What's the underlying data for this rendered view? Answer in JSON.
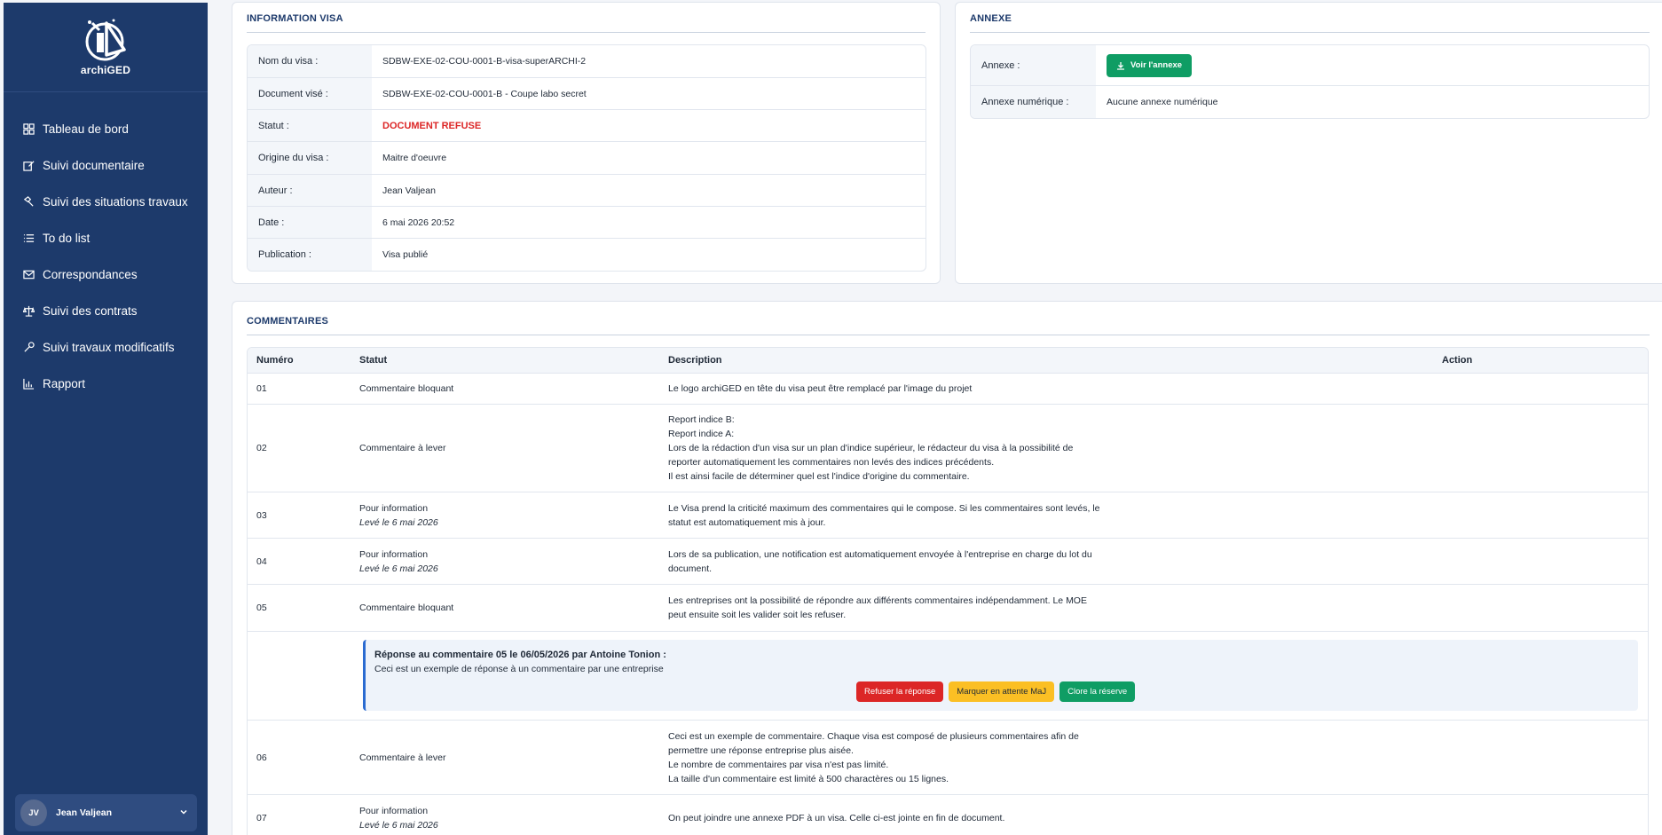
{
  "app": {
    "logo_text": "archiGED"
  },
  "sidebar": {
    "items": [
      {
        "label": "Tableau de bord",
        "icon": "grid-icon"
      },
      {
        "label": "Suivi documentaire",
        "icon": "edit-doc-icon"
      },
      {
        "label": "Suivi des situations travaux",
        "icon": "hammer-icon"
      },
      {
        "label": "To do list",
        "icon": "list-icon"
      },
      {
        "label": "Correspondances",
        "icon": "mail-icon"
      },
      {
        "label": "Suivi des contrats",
        "icon": "scale-icon"
      },
      {
        "label": "Suivi travaux modificatifs",
        "icon": "wrench-icon"
      },
      {
        "label": "Rapport",
        "icon": "bar-chart-icon"
      }
    ],
    "user": {
      "initials": "JV",
      "name": "Jean Valjean"
    }
  },
  "info_visa": {
    "title": "INFORMATION VISA",
    "rows": [
      {
        "label": "Nom du visa :",
        "value": "SDBW-EXE-02-COU-0001-B-visa-superARCHI-2"
      },
      {
        "label": "Document visé :",
        "value": "SDBW-EXE-02-COU-0001-B - Coupe labo secret"
      },
      {
        "label": "Statut :",
        "value": "DOCUMENT REFUSE"
      },
      {
        "label": "Origine du visa :",
        "value": "Maitre d'oeuvre"
      },
      {
        "label": "Auteur :",
        "value": "Jean Valjean"
      },
      {
        "label": "Date :",
        "value": "6 mai 2026 20:52"
      },
      {
        "label": "Publication :",
        "value": "Visa publié"
      }
    ],
    "status_color": "#dc2626"
  },
  "annexe": {
    "title": "ANNEXE",
    "annexe_label": "Annexe :",
    "button_label": "Voir l'annexe",
    "numerique_label": "Annexe numérique :",
    "numerique_value": "Aucune annexe numérique"
  },
  "commentaires": {
    "title": "COMMENTAIRES",
    "headers": {
      "num": "Numéro",
      "statut": "Statut",
      "description": "Description",
      "action": "Action"
    },
    "rows": [
      {
        "num": "01",
        "statut": "Commentaire bloquant",
        "leve": "",
        "desc": [
          "Le logo archiGED en tête du visa peut être remplacé par l'image du projet"
        ]
      },
      {
        "num": "02",
        "statut": "Commentaire à lever",
        "leve": "",
        "desc": [
          "Report indice B:",
          "Report indice A:",
          "Lors de la rédaction d'un visa sur un plan d'indice supérieur, le rédacteur du visa à la possibilité de",
          "reporter automatiquement les commentaires non levés des indices précédents.",
          "Il est ainsi facile de déterminer quel est l'indice d'origine du commentaire."
        ]
      },
      {
        "num": "03",
        "statut": "Pour information",
        "leve": "Levé le 6 mai 2026",
        "desc": [
          "Le Visa prend la criticité maximum des commentaires qui le compose. Si les commentaires sont levés, le",
          "statut est automatiquement mis à jour."
        ]
      },
      {
        "num": "04",
        "statut": "Pour information",
        "leve": "Levé le 6 mai 2026",
        "desc": [
          "Lors de sa publication, une notification est automatiquement envoyée à l'entreprise en charge du lot du",
          "document."
        ]
      },
      {
        "num": "05",
        "statut": "Commentaire bloquant",
        "leve": "",
        "desc": [
          "Les entreprises ont la possibilité de répondre aux différents commentaires indépendamment. Le MOE",
          "peut ensuite soit les valider soit les refuser."
        ]
      },
      {
        "num": "06",
        "statut": "Commentaire à lever",
        "leve": "",
        "desc": [
          "Ceci est un exemple de commentaire. Chaque visa est composé de plusieurs commentaires afin de",
          "permettre une réponse entreprise plus aisée.",
          "Le nombre de commentaires par visa n'est pas limité.",
          "La taille d'un commentaire est limité à 500 charactères ou 15 lignes."
        ]
      },
      {
        "num": "07",
        "statut": "Pour information",
        "leve": "Levé le 6 mai 2026",
        "desc": [
          "On peut joindre une annexe PDF à un visa. Celle ci-est jointe en fin de document."
        ]
      }
    ],
    "reply": {
      "title": "Réponse au commentaire 05 le 06/05/2026 par Antoine Tonion :",
      "text": "Ceci est un exemple de réponse à un commentaire par une entreprise",
      "btn_refuse": "Refuser la réponse",
      "btn_attente": "Marquer en attente MaJ",
      "btn_clore": "Clore la réserve"
    }
  },
  "colors": {
    "sidebar": "#1d3a6b",
    "accent_green": "#0f9d64",
    "danger": "#dc2626",
    "warning": "#fbbf24",
    "reply_border": "#2b6bd1"
  }
}
